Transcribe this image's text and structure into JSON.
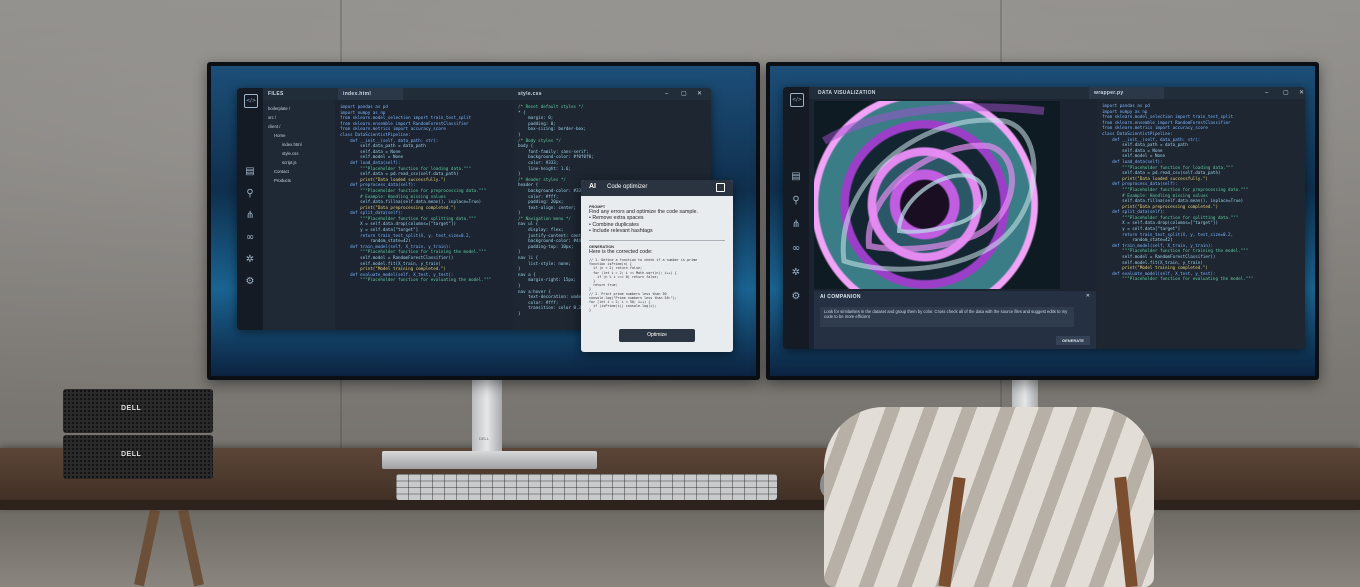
{
  "left_monitor": {
    "app": {
      "files_label": "FILES",
      "tree": [
        "boilerplate /",
        "src /",
        "client /",
        "Home",
        "index.html",
        "style.css",
        "script.js",
        "Contact",
        "Products"
      ],
      "tabs": [
        "index.html",
        "style.css"
      ],
      "window_controls": [
        "–",
        "▢",
        "✕"
      ],
      "py_code": [
        "import pandas as pd",
        "import numpy as np",
        "from sklearn.model_selection import train_test_split",
        "from sklearn.ensemble import RandomForestClassifier",
        "from sklearn.metrics import accuracy_score",
        "",
        "class DataScientistPipeline:",
        "    def __init__(self, data_path: str):",
        "        self.data_path = data_path",
        "        self.data = None",
        "        self.model = None",
        "",
        "    def load_data(self):",
        "        \"\"\"Placeholder function for loading data.\"\"\"",
        "        self.data = pd.read_csv(self.data_path)",
        "        print(\"Data loaded successfully.\")",
        "",
        "    def preprocess_data(self):",
        "        \"\"\"Placeholder function for preprocessing data.\"\"\"",
        "        # Example: Handling missing values",
        "        self.data.fillna(self.data.mean(), inplace=True)",
        "        print(\"Data preprocessing completed.\")",
        "",
        "    def split_data(self):",
        "        \"\"\"Placeholder function for splitting data.\"\"\"",
        "        X = self.data.drop(columns=[\"target\"])",
        "        y = self.data[\"target\"]",
        "        return train_test_split(X, y, test_size=0.2,",
        "            random_state=42)",
        "",
        "    def train_model(self, X_train, y_train):",
        "        \"\"\"Placeholder function for training the model.\"\"\"",
        "        self.model = RandomForestClassifier()",
        "        self.model.fit(X_train, y_train)",
        "        print(\"Model training completed.\")",
        "",
        "    def evaluate_model(self, X_test, y_test):",
        "        \"\"\"Placeholder function for evaluating the model.\"\"\""
      ],
      "css_code": [
        "/* Reset default styles */",
        "* {",
        "    margin: 0;",
        "    padding: 0;",
        "    box-sizing: border-box;",
        "}",
        "",
        "/* Body styles */",
        "body {",
        "    font-family: sans-serif;",
        "    background-color: #f0f0f0;",
        "    color: #333;",
        "    line-height: 1.6;",
        "}",
        "",
        "/* Header styles */",
        "header {",
        "    background-color: #333;",
        "    color: #fff;",
        "    padding: 20px;",
        "    text-align: center;",
        "}",
        "",
        "/* Navigation menu */",
        "nav ul {",
        "    display: flex;",
        "    justify-content: center;",
        "    background-color: #444;",
        "    padding-top: 10px;",
        "}",
        "",
        "nav li {",
        "    list-style: none;",
        "}",
        "",
        "nav a {",
        "    margin-right: 15px;",
        "}",
        "",
        "nav a:hover {",
        "    text-decoration: underline;",
        "    color: #fff;",
        "    transition: color 0.3s;",
        "}"
      ]
    },
    "popup": {
      "title": "Code optimizer",
      "ai_badge": "AI",
      "prompt_label": "PROMPT",
      "prompt_lines": [
        "Find any errors and optimize the code sample.",
        "• Remove extra spaces",
        "• Combine duplicates",
        "• Include relevant hashtags"
      ],
      "generation_label": "GENERATION",
      "generation_text": "Here is the corrected code:",
      "generated_code": [
        "// 1. Define a function to check if a number is prime",
        "function isPrime(n) {",
        "  if (n < 2) return false;",
        "  for (let i = 2; i <= Math.sqrt(n); i++) {",
        "    if (n % i === 0) return false;",
        "  }",
        "  return true;",
        "}",
        "",
        "// 2. Print prime numbers less than 50",
        "console.log(\"Prime numbers less than 50:\");",
        "for (let i = 2; i < 50; i++) {",
        "  if (isPrime(i)) console.log(i);",
        "}"
      ],
      "button": "Optimize"
    }
  },
  "right_monitor": {
    "app": {
      "viz_label": "DATA VISUALIZATION",
      "tabs": [
        "wrapper.py"
      ],
      "window_controls": [
        "–",
        "▢",
        "✕"
      ],
      "companion_title": "AI COMPANION",
      "companion_text": "Look for similarities in the dataset and group them by color. Cross check all of the data with the source files and suggest edits to my code to be more efficient",
      "generate_button": "GENERATE",
      "close": "✕",
      "py_code": [
        "import pandas as pd",
        "import numpy as np",
        "from sklearn.model_selection import train_test_split",
        "from sklearn.ensemble import RandomForestClassifier",
        "from sklearn.metrics import accuracy_score",
        "",
        "class DataScientistPipeline:",
        "    def __init__(self, data_path: str):",
        "        self.data_path = data_path",
        "        self.data = None",
        "        self.model = None",
        "",
        "    def load_data(self):",
        "        \"\"\"Placeholder function for loading data.\"\"\"",
        "        self.data = pd.read_csv(self.data_path)",
        "        print(\"Data loaded successfully.\")",
        "",
        "    def preprocess_data(self):",
        "        \"\"\"Placeholder function for preprocessing data.\"\"\"",
        "        # Example: Handling missing values",
        "        self.data.fillna(self.data.mean(), inplace=True)",
        "        print(\"Data preprocessing completed.\")",
        "",
        "    def split_data(self):",
        "        \"\"\"Placeholder function for splitting data.\"\"\"",
        "        X = self.data.drop(columns=[\"target\"])",
        "        y = self.data[\"target\"]",
        "        return train_test_split(X, y, test_size=0.2,",
        "            random_state=42)",
        "",
        "    def train_model(self, X_train, y_train):",
        "        \"\"\"Placeholder function for training the model.\"\"\"",
        "        self.model = RandomForestClassifier()",
        "        self.model.fit(X_train, y_train)",
        "        print(\"Model training completed.\")",
        "",
        "    def evaluate_model(self, X_test, y_test):",
        "        \"\"\"Placeholder function for evaluating the model.\"\"\""
      ]
    }
  },
  "hardware": {
    "pc_brand_top": "DELL",
    "pc_brand_bottom": "DELL",
    "stand_brand": "DELL"
  }
}
